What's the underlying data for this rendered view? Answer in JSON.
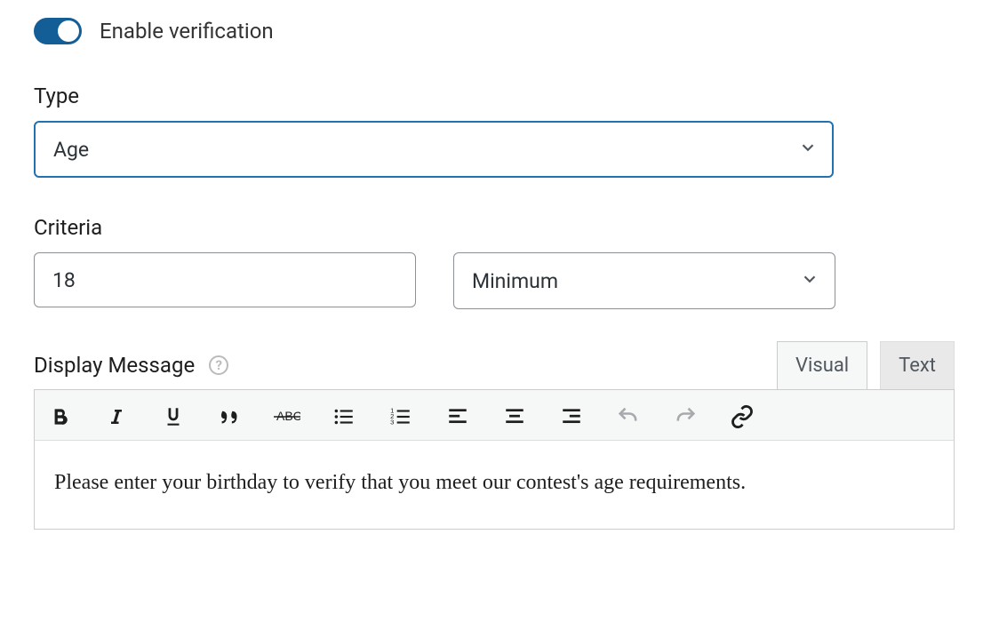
{
  "enable": {
    "label": "Enable verification",
    "on": true
  },
  "type": {
    "label": "Type",
    "value": "Age"
  },
  "criteria": {
    "label": "Criteria",
    "value": "18",
    "mode": "Minimum"
  },
  "editor": {
    "section_label": "Display Message",
    "tabs": {
      "visual": "Visual",
      "text": "Text"
    },
    "content": "Please enter your birthday to verify that you meet our contest's age requirements."
  }
}
